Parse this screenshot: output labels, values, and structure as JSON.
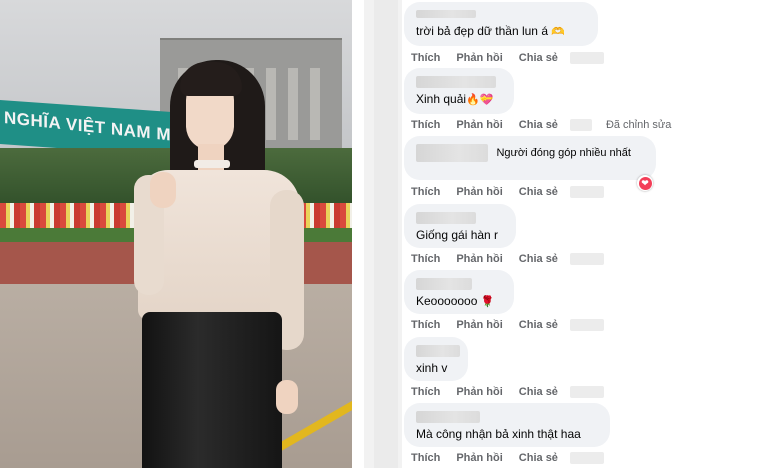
{
  "photo": {
    "sign_text": "NGHĨA VIỆT NAM MUÔN N"
  },
  "actions": {
    "like": "Thích",
    "reply": "Phản hồi",
    "share": "Chia sẻ",
    "edited": "Đã chỉnh sửa"
  },
  "comments": [
    {
      "text": "trời bả đẹp dữ thần lun á",
      "emoji": "🫶"
    },
    {
      "text": "Xinh quải",
      "emoji": "🔥💝"
    },
    {
      "badge": "Người đóng góp nhiều nhất",
      "reaction": "❤"
    },
    {
      "text": "Giống gái hàn r"
    },
    {
      "text": "Keooooooo",
      "emoji": "🌹"
    },
    {
      "text": "xinh v"
    },
    {
      "text": "Mà công nhận bả xinh thật haa"
    }
  ],
  "colors": {
    "bubble": "#f0f2f5",
    "action_text": "#65676b",
    "heart": "#f33e58"
  }
}
